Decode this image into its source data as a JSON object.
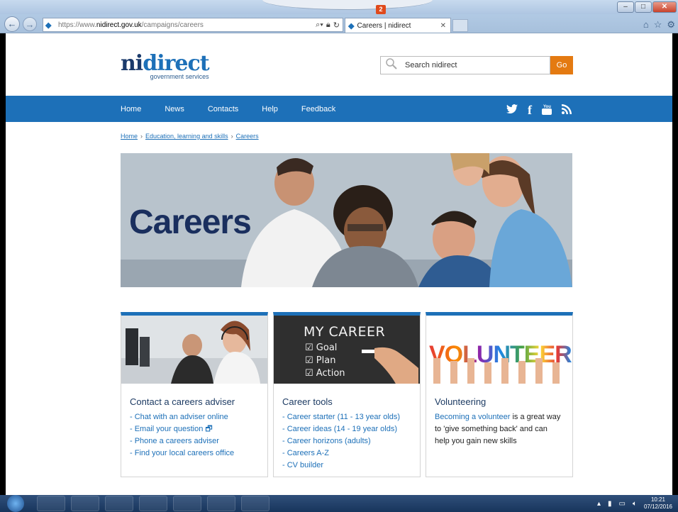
{
  "browser": {
    "url_prefix": "https://www.",
    "url_domain": "nidirect.gov.uk",
    "url_path": "/campaigns/careers",
    "tab_title": "Careers | nidirect",
    "notification_count": "2"
  },
  "header": {
    "logo_ni": "ni",
    "logo_direct": "direct",
    "logo_sub": "government services",
    "search_placeholder": "Search nidirect",
    "go_label": "Go"
  },
  "nav": {
    "items": [
      "Home",
      "News",
      "Contacts",
      "Help",
      "Feedback"
    ]
  },
  "breadcrumb": [
    "Home",
    "Education, learning and skills",
    "Careers"
  ],
  "hero": {
    "title": "Careers"
  },
  "cards": [
    {
      "title": "Contact a careers adviser",
      "links": [
        "- Chat with an adviser online",
        "- Email your question",
        "- Phone a careers adviser",
        "- Find your local careers office"
      ]
    },
    {
      "title": "Career tools",
      "image_text": {
        "heading": "MY CAREER",
        "items": [
          "Goal",
          "Plan",
          "Action"
        ]
      },
      "links": [
        "- Career starter (11 - 13 year olds)",
        "- Career ideas (14 - 19 year olds)",
        "- Career horizons (adults)",
        "- Careers A-Z",
        "- CV builder"
      ]
    },
    {
      "title": "Volunteering",
      "image_text": "VOLUNTEER",
      "link_text": "Becoming a volunteer",
      "body_text": " is a great way to 'give something back' and can help you gain new skills"
    }
  ],
  "taskbar": {
    "time": "10:21",
    "date": "07/12/2016"
  },
  "colors": {
    "brand_blue": "#1d70b8",
    "go_orange": "#e47a11",
    "navy": "#1a2f5e"
  }
}
